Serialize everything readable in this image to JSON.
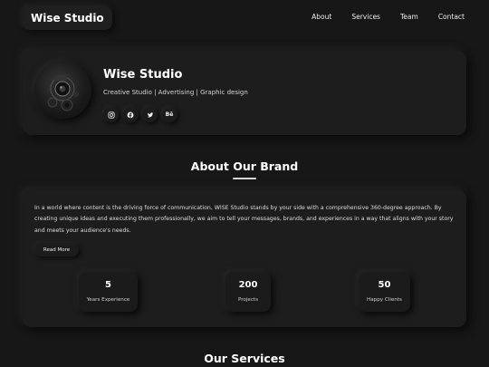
{
  "header": {
    "brand": "Wise Studio",
    "nav": [
      "About",
      "Services",
      "Team",
      "Contact"
    ]
  },
  "profile": {
    "name": "Wise Studio",
    "tagline": "Creative Studio | Advertising | Graphic design",
    "avatar_icon": "camera-photo",
    "socials": [
      {
        "name": "instagram-icon",
        "glyph": ""
      },
      {
        "name": "facebook-icon",
        "glyph": ""
      },
      {
        "name": "twitter-icon",
        "glyph": ""
      },
      {
        "name": "behance-icon",
        "glyph": "Bē"
      }
    ]
  },
  "about": {
    "title": "About Our Brand",
    "text": "In a world where content is the driving force of communication, WISE Studio stands by your side with a comprehensive 360-degree approach. By creating unique ideas and executing them professionally, we aim to tell your messages, brands, and experiences in a way that aligns with your story and meets your audience's needs.",
    "read_more": "Read More",
    "stats": [
      {
        "value": "5",
        "label": "Years Experience"
      },
      {
        "value": "200",
        "label": "Projects"
      },
      {
        "value": "50",
        "label": "Happy Clients"
      }
    ]
  },
  "services": {
    "title": "Our Services"
  },
  "colors": {
    "background": "#171717",
    "card": "#1d1d1d",
    "text": "#ffffff"
  }
}
